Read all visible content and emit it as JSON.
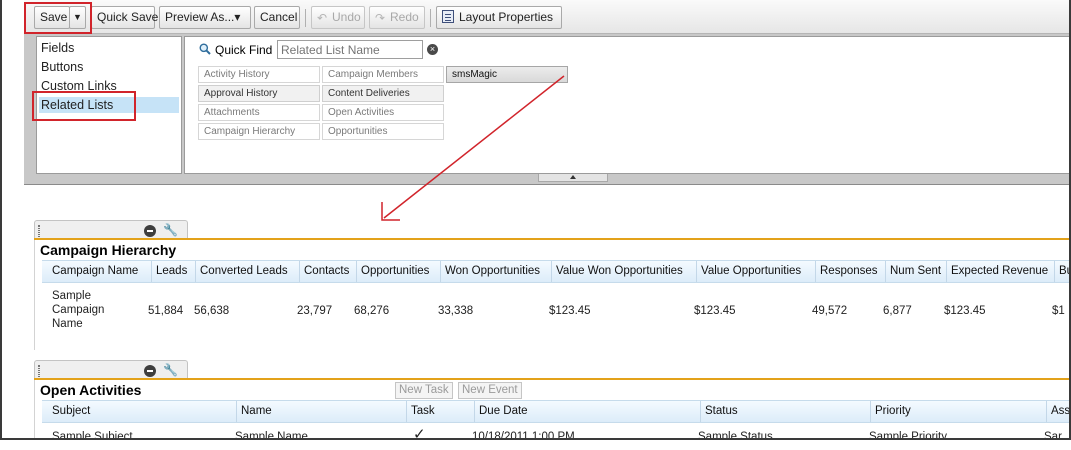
{
  "toolbar": {
    "save_label": "Save",
    "save_dropdown": "▼",
    "quick_save_label": "Quick Save",
    "preview_label": "Preview As...▾",
    "cancel_label": "Cancel",
    "undo_label": "Undo",
    "redo_label": "Redo",
    "layout_properties_label": "Layout Properties"
  },
  "palette": {
    "categories": [
      "Fields",
      "Buttons",
      "Custom Links",
      "Related Lists"
    ],
    "selected_category": "Related Lists",
    "quick_find_label": "Quick Find",
    "quick_find_placeholder": "Related List Name",
    "clear_symbol": "×",
    "related_lists": [
      [
        "Activity History",
        "Approval History",
        "Attachments",
        "Campaign Hierarchy"
      ],
      [
        "Campaign Members",
        "Content Deliveries",
        "Open Activities",
        "Opportunities"
      ],
      [
        "smsMagic"
      ]
    ]
  },
  "sections": {
    "campaign_hierarchy": {
      "title": "Campaign Hierarchy",
      "columns": [
        "Campaign Name",
        "Leads",
        "Converted Leads",
        "Contacts",
        "Opportunities",
        "Won Opportunities",
        "Value Won Opportunities",
        "Value Opportunities",
        "Responses",
        "Num Sent",
        "Expected Revenue",
        "Bu"
      ],
      "row": [
        "Sample Campaign Name",
        "51,884",
        "56,638",
        "23,797",
        "68,276",
        "33,338",
        "$123.45",
        "$123.45",
        "49,572",
        "6,877",
        "$123.45",
        "$1"
      ]
    },
    "open_activities": {
      "title": "Open Activities",
      "new_task_label": "New Task",
      "new_event_label": "New Event",
      "columns": [
        "Subject",
        "Name",
        "Task",
        "Due Date",
        "Status",
        "Priority",
        "Ass"
      ],
      "row": [
        "Sample Subject",
        "Sample Name",
        "✓",
        "10/18/2011 1:00 PM",
        "Sample Status",
        "Sample Priority",
        "Sar"
      ]
    }
  },
  "colors": {
    "annotation_red": "#d1242b",
    "section_accent": "#e3a21a",
    "header_blue": "#dcecf9",
    "selected_blue": "#c6e3f7"
  }
}
